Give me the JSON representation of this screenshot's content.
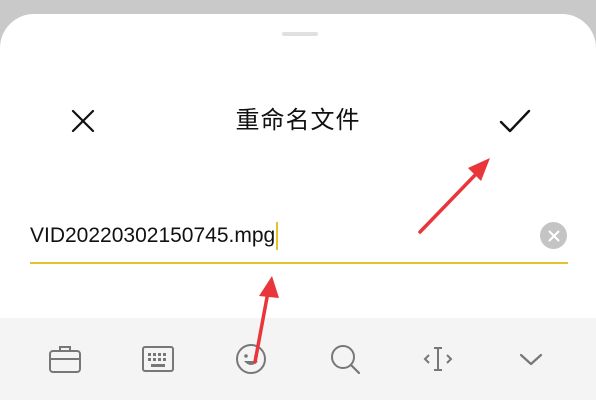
{
  "dialog": {
    "title": "重命名文件",
    "close_icon": "close-icon",
    "confirm_icon": "checkmark-icon"
  },
  "filename_field": {
    "value": "VID20220302150745.mpg",
    "clear_icon": "clear-circle-icon",
    "underline_color": "#e5c12a"
  },
  "keyboard_toolbar": {
    "items": [
      {
        "icon": "briefcase-icon"
      },
      {
        "icon": "keyboard-icon"
      },
      {
        "icon": "emoji-icon"
      },
      {
        "icon": "search-icon"
      },
      {
        "icon": "text-cursor-icon"
      },
      {
        "icon": "chevron-down-icon"
      }
    ]
  },
  "colors": {
    "accent": "#e5c12a",
    "annotation_arrow": "#e8363a"
  }
}
